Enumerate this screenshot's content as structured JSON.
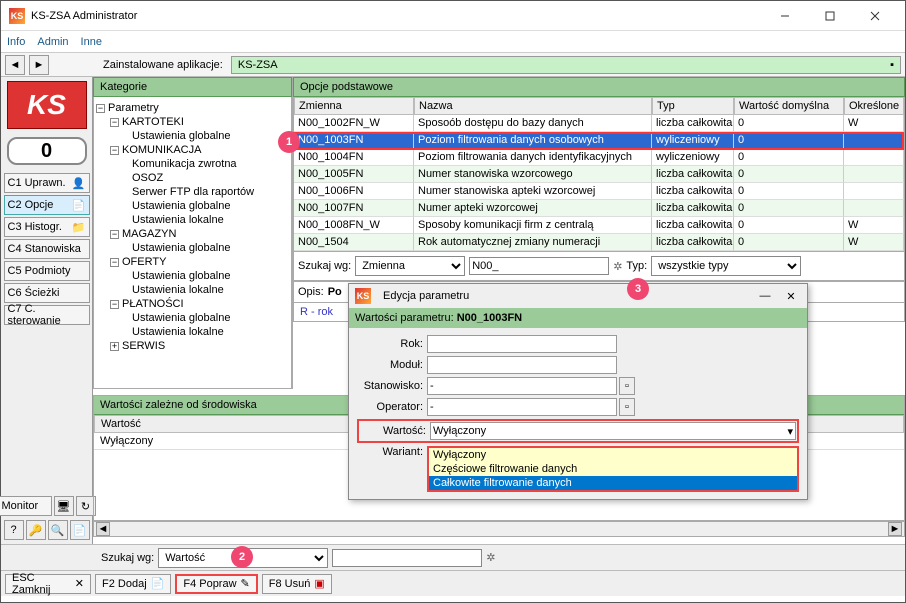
{
  "window": {
    "title": "KS-ZSA Administrator"
  },
  "menu": {
    "info": "Info",
    "admin": "Admin",
    "inne": "Inne"
  },
  "installed": {
    "label": "Zainstalowane aplikacje:",
    "value": "KS-ZSA"
  },
  "counter": "0",
  "sidebar": {
    "items": [
      {
        "label": "C1 Uprawn."
      },
      {
        "label": "C2 Opcje"
      },
      {
        "label": "C3 Histogr."
      },
      {
        "label": "C4 Stanowiska"
      },
      {
        "label": "C5 Podmioty"
      },
      {
        "label": "C6 Ścieżki"
      },
      {
        "label": "C7 C. sterowanie"
      }
    ],
    "monitor": "Monitor"
  },
  "categories": {
    "title": "Kategorie",
    "nodes": {
      "root": "Parametry",
      "n1": "KARTOTEKI",
      "n1a": "Ustawienia globalne",
      "n2": "KOMUNIKACJA",
      "n2a": "Komunikacja zwrotna",
      "n2b": "OSOZ",
      "n2c": "Serwer FTP dla raportów",
      "n2d": "Ustawienia globalne",
      "n2e": "Ustawienia lokalne",
      "n3": "MAGAZYN",
      "n3a": "Ustawienia globalne",
      "n4": "OFERTY",
      "n4a": "Ustawienia globalne",
      "n4b": "Ustawienia lokalne",
      "n5": "PŁATNOŚCI",
      "n5a": "Ustawienia globalne",
      "n5b": "Ustawienia lokalne",
      "n6": "SERWIS"
    }
  },
  "options": {
    "title": "Opcje podstawowe",
    "headers": {
      "var": "Zmienna",
      "name": "Nazwa",
      "type": "Typ",
      "def": "Wartość domyślna",
      "set": "Określone"
    },
    "rows": [
      {
        "var": "N00_1002FN_W",
        "name": "Sposoób dostępu do bazy danych",
        "type": "liczba całkowita",
        "def": "0",
        "set": "W"
      },
      {
        "var": "N00_1003FN",
        "name": "Poziom filtrowania danych osobowych",
        "type": "wyliczeniowy",
        "def": "0",
        "set": ""
      },
      {
        "var": "N00_1004FN",
        "name": "Poziom filtrowania danych identyfikacyjnych",
        "type": "wyliczeniowy",
        "def": "0",
        "set": ""
      },
      {
        "var": "N00_1005FN",
        "name": "Numer stanowiska wzorcowego",
        "type": "liczba całkowita",
        "def": "0",
        "set": ""
      },
      {
        "var": "N00_1006FN",
        "name": "Numer stanowiska apteki wzorcowej",
        "type": "liczba całkowita",
        "def": "0",
        "set": ""
      },
      {
        "var": "N00_1007FN",
        "name": "Numer apteki wzorcowej",
        "type": "liczba całkowita",
        "def": "0",
        "set": ""
      },
      {
        "var": "N00_1008FN_W",
        "name": "Sposoby komunikacji firm z centralą",
        "type": "liczba całkowita",
        "def": "0",
        "set": "W"
      },
      {
        "var": "N00_1504",
        "name": "Rok automatycznej zmiany numeracji",
        "type": "liczba całkowita",
        "def": "0",
        "set": "W"
      }
    ],
    "search": {
      "label": "Szukaj wg:",
      "fieldsel": "Zmienna",
      "value": "N00_",
      "typlabel": "Typ:",
      "typesel": "wszystkie typy"
    },
    "opis": {
      "label": "Opis:",
      "value": "Po"
    },
    "legend": "R - rok"
  },
  "envvals": {
    "title": "Wartości zależne od środowiska",
    "header": "Wartość",
    "row0": "Wyłączony"
  },
  "dialog": {
    "title": "Edycja parametru",
    "subtitle_pre": "Wartości parametru:",
    "subtitle_val": "N00_1003FN",
    "rows": {
      "rok": "Rok:",
      "modul": "Moduł:",
      "stan": "Stanowisko:",
      "stan_v": "-",
      "oper": "Operator:",
      "oper_v": "-",
      "wart": "Wartość:",
      "wart_v": "Wyłączony",
      "variant": "Wariant:"
    },
    "dd": {
      "o1": "Wyłączony",
      "o2": "Częściowe filtrowanie danych",
      "o3": "Całkowite filtrowanie danych"
    }
  },
  "search2": {
    "label": "Szukaj wg:",
    "sel": "Wartość",
    "value": ""
  },
  "footer": {
    "esc": "ESC Zamknij",
    "f2": "F2 Dodaj",
    "f4": "F4 Popraw",
    "f8": "F8 Usuń"
  },
  "markers": {
    "m1": "1",
    "m2": "2",
    "m3": "3"
  }
}
